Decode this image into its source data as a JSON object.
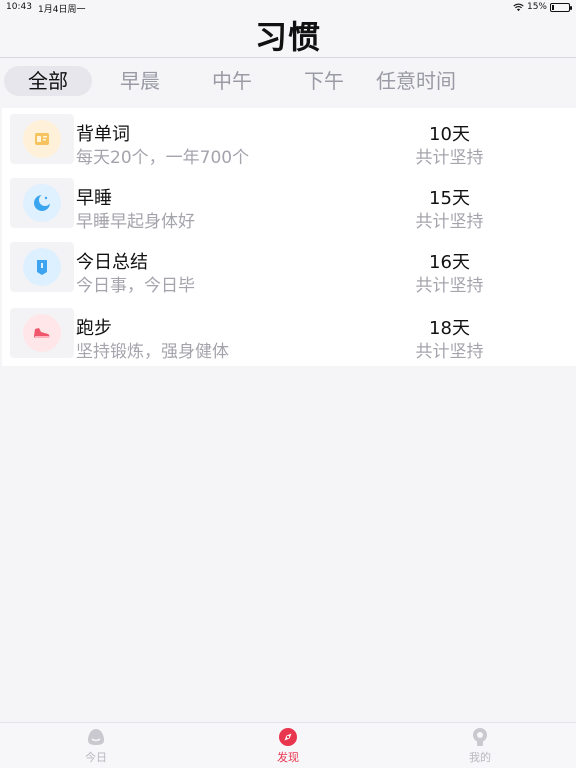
{
  "status_bar": {
    "time": "10:43",
    "date": "1月4日周一",
    "battery": "15%",
    "battery_level": 0.15
  },
  "nav": {
    "title": "习惯"
  },
  "tabs": [
    {
      "label": "全部",
      "active": true
    },
    {
      "label": "早晨",
      "active": false
    },
    {
      "label": "中午",
      "active": false
    },
    {
      "label": "下午",
      "active": false
    },
    {
      "label": "任意时间",
      "active": false
    }
  ],
  "habits": [
    {
      "name": "背单词",
      "description": "每天20个，一年700个",
      "days": "10天",
      "status": "共计坚持",
      "icon": "vocabulary-card-icon",
      "icon_bg": "#fff1d9",
      "icon_color": "#f5b543"
    },
    {
      "name": "早睡",
      "description": "早睡早起身体好",
      "days": "15天",
      "status": "共计坚持",
      "icon": "moon-icon",
      "icon_bg": "#dff0ff",
      "icon_color": "#3aa6f0"
    },
    {
      "name": "今日总结",
      "description": "今日事，今日毕",
      "days": "16天",
      "status": "共计坚持",
      "icon": "summary-note-icon",
      "icon_bg": "#dcf0ff",
      "icon_color": "#3fa4ef"
    },
    {
      "name": "跑步",
      "description": "坚持锻炼，强身健体",
      "days": "18天",
      "status": "共计坚持",
      "icon": "running-shoe-icon",
      "icon_bg": "#ffe6e9",
      "icon_color": "#f0566b"
    }
  ],
  "tab_bar": [
    {
      "label": "今日",
      "icon": "today-blob-icon",
      "active": false
    },
    {
      "label": "发现",
      "icon": "discover-compass-icon",
      "active": true
    },
    {
      "label": "我的",
      "icon": "profile-icon",
      "active": false
    }
  ],
  "colors": {
    "accent": "#e8364f",
    "inactive": "#b8b8bf",
    "secondary_text": "#a4a4ad"
  }
}
